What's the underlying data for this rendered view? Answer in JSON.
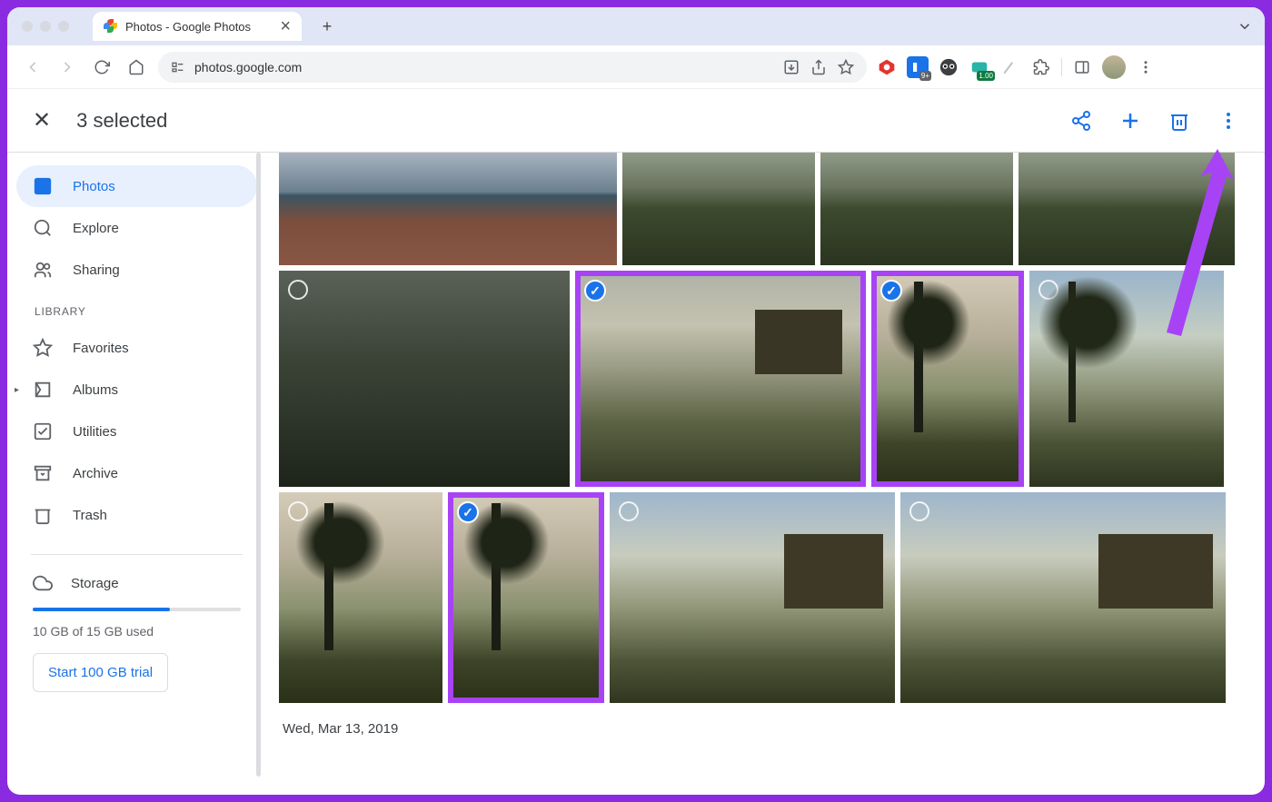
{
  "browser": {
    "tab_title": "Photos - Google Photos",
    "url": "photos.google.com"
  },
  "appbar": {
    "title": "3 selected"
  },
  "sidebar": {
    "items": [
      {
        "label": "Photos"
      },
      {
        "label": "Explore"
      },
      {
        "label": "Sharing"
      }
    ],
    "library_label": "LIBRARY",
    "library": [
      {
        "label": "Favorites"
      },
      {
        "label": "Albums"
      },
      {
        "label": "Utilities"
      },
      {
        "label": "Archive"
      },
      {
        "label": "Trash"
      }
    ],
    "storage": {
      "label": "Storage",
      "usage": "10 GB of 15 GB used",
      "trial": "Start 100 GB trial",
      "percent": 66
    }
  },
  "gallery": {
    "date": "Wed, Mar 13, 2019"
  },
  "ext_badges": {
    "count": "9+",
    "ver": "1.00"
  }
}
